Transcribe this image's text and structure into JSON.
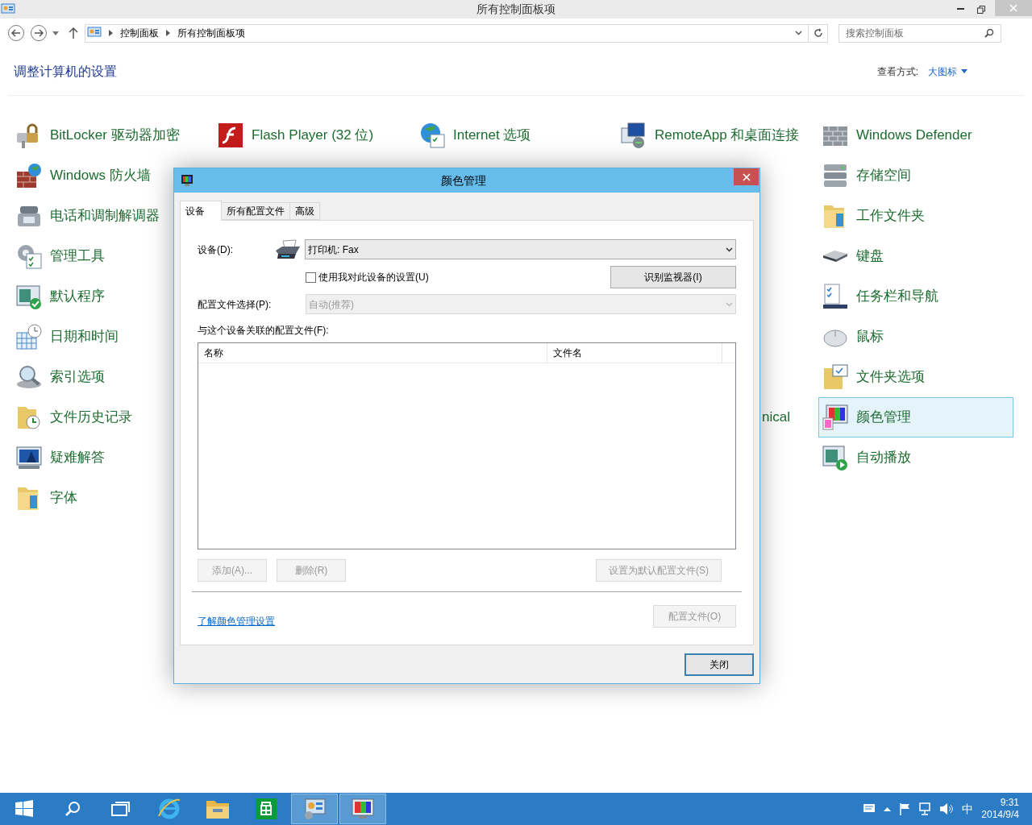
{
  "window": {
    "title": "所有控制面板项"
  },
  "address_bar": {
    "path": [
      "控制面板",
      "所有控制面板项"
    ]
  },
  "search": {
    "placeholder": "搜索控制面板"
  },
  "heading": "调整计算机的设置",
  "view_by": {
    "label": "查看方式:",
    "value": "大图标"
  },
  "columns": [
    [
      {
        "kind": "item",
        "label": "BitLocker 驱动器加密",
        "selected": false
      },
      {
        "kind": "item",
        "label": "Windows 防火墙",
        "selected": false
      },
      {
        "kind": "item",
        "label": "电话和调制解调器",
        "selected": false
      },
      {
        "kind": "item",
        "label": "管理工具",
        "selected": false
      },
      {
        "kind": "item",
        "label": "默认程序",
        "selected": false
      },
      {
        "kind": "item",
        "label": "日期和时间",
        "selected": false
      },
      {
        "kind": "item",
        "label": "索引选项",
        "selected": false
      },
      {
        "kind": "item",
        "label": "文件历史记录",
        "selected": false
      },
      {
        "kind": "item",
        "label": "疑难解答",
        "selected": false
      },
      {
        "kind": "item",
        "label": "字体",
        "selected": false
      }
    ],
    [
      {
        "kind": "item",
        "label": "Flash Player (32 位)",
        "selected": false
      }
    ],
    [
      {
        "kind": "item",
        "label": "Internet 选项",
        "selected": false
      }
    ],
    [
      {
        "kind": "item",
        "label": "RemoteApp 和桌面连接",
        "selected": false
      },
      {
        "kind": "covered"
      },
      {
        "kind": "covered"
      },
      {
        "kind": "covered"
      },
      {
        "kind": "covered"
      },
      {
        "kind": "covered"
      },
      {
        "kind": "covered"
      },
      {
        "kind": "cut",
        "label": "nical"
      }
    ],
    [
      {
        "kind": "item",
        "label": "Windows Defender",
        "selected": false
      },
      {
        "kind": "item",
        "label": "存储空间",
        "selected": false
      },
      {
        "kind": "item",
        "label": "工作文件夹",
        "selected": false
      },
      {
        "kind": "item",
        "label": "键盘",
        "selected": false
      },
      {
        "kind": "item",
        "label": "任务栏和导航",
        "selected": false
      },
      {
        "kind": "item",
        "label": "鼠标",
        "selected": false
      },
      {
        "kind": "item",
        "label": "文件夹选项",
        "selected": false
      },
      {
        "kind": "item",
        "label": "颜色管理",
        "selected": true
      },
      {
        "kind": "item",
        "label": "自动播放",
        "selected": false
      }
    ]
  ],
  "dialog": {
    "title": "颜色管理",
    "tabs": [
      {
        "label": "设备",
        "selected": true
      },
      {
        "label": "所有配置文件",
        "selected": false
      },
      {
        "label": "高级",
        "selected": false
      }
    ],
    "device": {
      "label": "设备(D):",
      "value": "打印机: Fax"
    },
    "use_my_settings": {
      "label": "使用我对此设备的设置(U)",
      "checked": false
    },
    "identify_button": "识别监视器(I)",
    "profile_selection": {
      "label": "配置文件选择(P):",
      "value": "自动(推荐)",
      "disabled": true
    },
    "list_label": "与这个设备关联的配置文件(F):",
    "table": {
      "columns": [
        "名称",
        "文件名"
      ]
    },
    "buttons": [
      {
        "label": "添加(A)...",
        "disabled": true
      },
      {
        "label": "删除(R)",
        "disabled": true
      },
      {
        "label": "设置为默认配置文件(S)",
        "disabled": true
      }
    ],
    "link": "了解颜色管理设置",
    "profiles_button": {
      "label": "配置文件(O)",
      "disabled": true
    },
    "close_button": "关闭"
  },
  "taskbar": {
    "apps": [
      {
        "selected": false
      },
      {
        "selected": false
      },
      {
        "selected": false
      },
      {
        "selected": false
      },
      {
        "selected": false
      },
      {
        "selected": false
      },
      {
        "selected": true
      },
      {
        "selected": true
      }
    ],
    "ime": "中",
    "time": "9:31",
    "date": "2014/9/4"
  }
}
